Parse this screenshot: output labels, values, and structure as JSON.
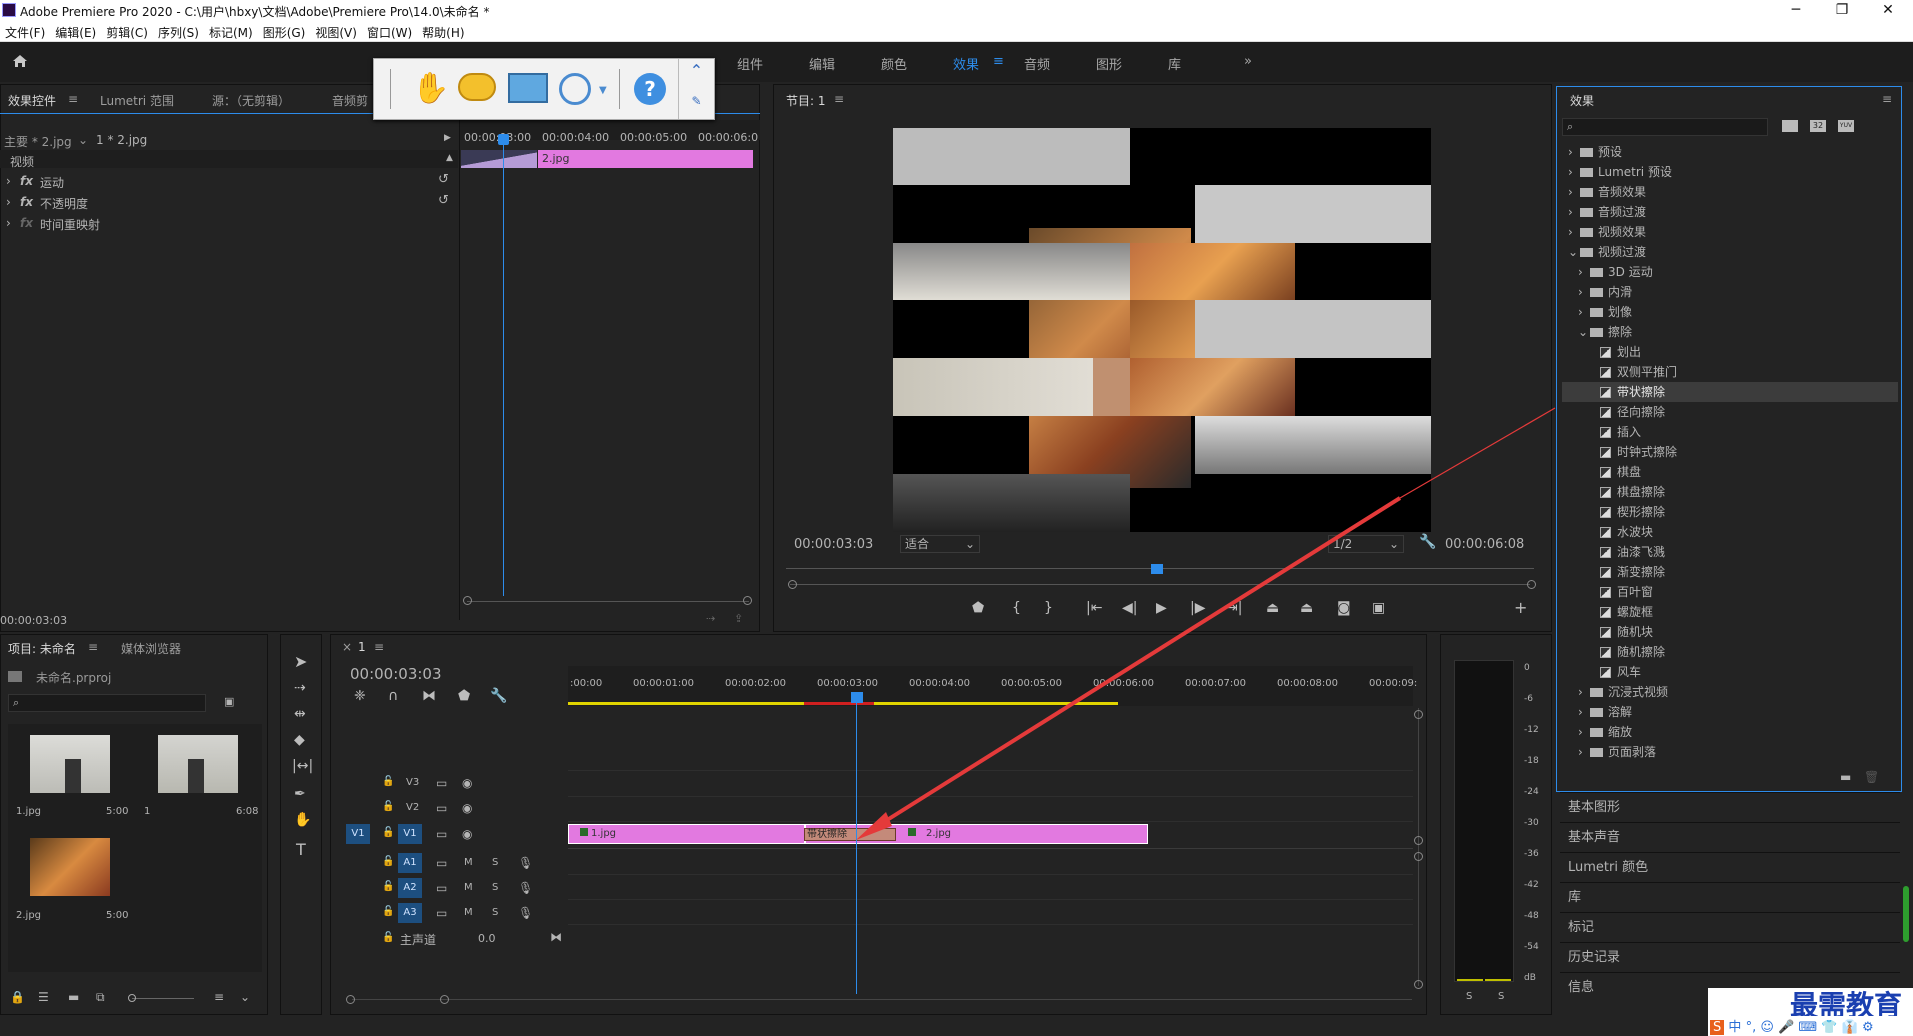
{
  "window": {
    "title": "Adobe Premiere Pro 2020 - C:\\用户\\hbxy\\文档\\Adobe\\Premiere Pro\\14.0\\未命名 *",
    "min": "─",
    "max": "❐",
    "close": "✕"
  },
  "menu": [
    "文件(F)",
    "编辑(E)",
    "剪辑(C)",
    "序列(S)",
    "标记(M)",
    "图形(G)",
    "视图(V)",
    "窗口(W)",
    "帮助(H)"
  ],
  "workspaces": [
    {
      "label": "组件",
      "active": false
    },
    {
      "label": "编辑",
      "active": false
    },
    {
      "label": "颜色",
      "active": false
    },
    {
      "label": "效果",
      "active": true
    },
    {
      "label": "音频",
      "active": false
    },
    {
      "label": "图形",
      "active": false
    },
    {
      "label": "库",
      "active": false
    }
  ],
  "workspace_more": "»",
  "effect_controls": {
    "tabs": [
      "效果控件",
      "Lumetri 范围",
      "源：（无剪辑）",
      "音频剪"
    ],
    "master": "主要 * 2.jpg",
    "clip": "1 * 2.jpg",
    "video_label": "视频",
    "rows": [
      "运动",
      "不透明度",
      "时间重映射"
    ],
    "ruler": [
      "00:00:03:00",
      "00:00:04:00",
      "00:00:05:00",
      "00:00:06:0"
    ],
    "clip_name": "2.jpg",
    "timecode": "00:00:03:03"
  },
  "program": {
    "title": "节目: 1",
    "timecode": "00:00:03:03",
    "fit": "适合",
    "quality": "1/2",
    "duration": "00:00:06:08"
  },
  "project": {
    "tabs": [
      "项目: 未命名",
      "媒体浏览器"
    ],
    "file": "未命名.prproj",
    "items": [
      {
        "name": "1.jpg",
        "dur": "5:00"
      },
      {
        "name": "1",
        "dur": "6:08"
      },
      {
        "name": "2.jpg",
        "dur": "5:00"
      }
    ]
  },
  "timeline": {
    "tab": "1",
    "timecode": "00:00:03:03",
    "ruler": [
      ":00:00",
      "00:00:01:00",
      "00:00:02:00",
      "00:00:03:00",
      "00:00:04:00",
      "00:00:05:00",
      "00:00:06:00",
      "00:00:07:00",
      "00:00:08:00",
      "00:00:09:"
    ],
    "tracks": [
      {
        "name": "V3"
      },
      {
        "name": "V2"
      },
      {
        "name": "V1"
      },
      {
        "name": "A1"
      },
      {
        "name": "A2"
      },
      {
        "name": "A3"
      }
    ],
    "master": "主声道",
    "master_val": "0.0",
    "clip1": "1.jpg",
    "clip2": "2.jpg",
    "transition": "带状擦除",
    "src_patch": "V1",
    "m": "M",
    "s": "S"
  },
  "meter": {
    "ticks": [
      "0",
      "-6",
      "-12",
      "-18",
      "-24",
      "-30",
      "-36",
      "-42",
      "-48",
      "-54",
      "dB"
    ],
    "solo": [
      "S",
      "S"
    ]
  },
  "effects": {
    "title": "效果",
    "tree": [
      {
        "label": "预设",
        "level": 0,
        "type": "folder",
        "arrow": "›"
      },
      {
        "label": "Lumetri 预设",
        "level": 0,
        "type": "folder",
        "arrow": "›"
      },
      {
        "label": "音频效果",
        "level": 0,
        "type": "folder",
        "arrow": "›"
      },
      {
        "label": "音频过渡",
        "level": 0,
        "type": "folder",
        "arrow": "›"
      },
      {
        "label": "视频效果",
        "level": 0,
        "type": "folder",
        "arrow": "›"
      },
      {
        "label": "视频过渡",
        "level": 0,
        "type": "folder",
        "arrow": "⌄"
      },
      {
        "label": "3D 运动",
        "level": 1,
        "type": "folder",
        "arrow": "›"
      },
      {
        "label": "内滑",
        "level": 1,
        "type": "folder",
        "arrow": "›"
      },
      {
        "label": "划像",
        "level": 1,
        "type": "folder",
        "arrow": "›"
      },
      {
        "label": "擦除",
        "level": 1,
        "type": "folder",
        "arrow": "⌄"
      },
      {
        "label": "划出",
        "level": 2,
        "type": "fx"
      },
      {
        "label": "双侧平推门",
        "level": 2,
        "type": "fx"
      },
      {
        "label": "带状擦除",
        "level": 2,
        "type": "fx",
        "selected": true
      },
      {
        "label": "径向擦除",
        "level": 2,
        "type": "fx"
      },
      {
        "label": "插入",
        "level": 2,
        "type": "fx"
      },
      {
        "label": "时钟式擦除",
        "level": 2,
        "type": "fx"
      },
      {
        "label": "棋盘",
        "level": 2,
        "type": "fx"
      },
      {
        "label": "棋盘擦除",
        "level": 2,
        "type": "fx"
      },
      {
        "label": "楔形擦除",
        "level": 2,
        "type": "fx"
      },
      {
        "label": "水波块",
        "level": 2,
        "type": "fx"
      },
      {
        "label": "油漆飞溅",
        "level": 2,
        "type": "fx"
      },
      {
        "label": "渐变擦除",
        "level": 2,
        "type": "fx"
      },
      {
        "label": "百叶窗",
        "level": 2,
        "type": "fx"
      },
      {
        "label": "螺旋框",
        "level": 2,
        "type": "fx"
      },
      {
        "label": "随机块",
        "level": 2,
        "type": "fx"
      },
      {
        "label": "随机擦除",
        "level": 2,
        "type": "fx"
      },
      {
        "label": "风车",
        "level": 2,
        "type": "fx"
      },
      {
        "label": "沉浸式视频",
        "level": 1,
        "type": "folder",
        "arrow": "›"
      },
      {
        "label": "溶解",
        "level": 1,
        "type": "folder",
        "arrow": "›"
      },
      {
        "label": "缩放",
        "level": 1,
        "type": "folder",
        "arrow": "›"
      },
      {
        "label": "页面剥落",
        "level": 1,
        "type": "folder",
        "arrow": "›"
      }
    ],
    "icons": [
      "32",
      "YUV"
    ]
  },
  "right_panels": [
    "基本图形",
    "基本声音",
    "Lumetri 颜色",
    "库",
    "标记",
    "历史记录",
    "信息"
  ],
  "watermark": "最需教育",
  "ime": [
    "S",
    "中",
    "°,",
    "☺",
    "🎤",
    "⌨",
    "👕",
    "👔",
    "⚙"
  ],
  "colors": {
    "accent": "#2d8ceb",
    "clip": "#e279e0",
    "arrow": "#e43a3a"
  }
}
